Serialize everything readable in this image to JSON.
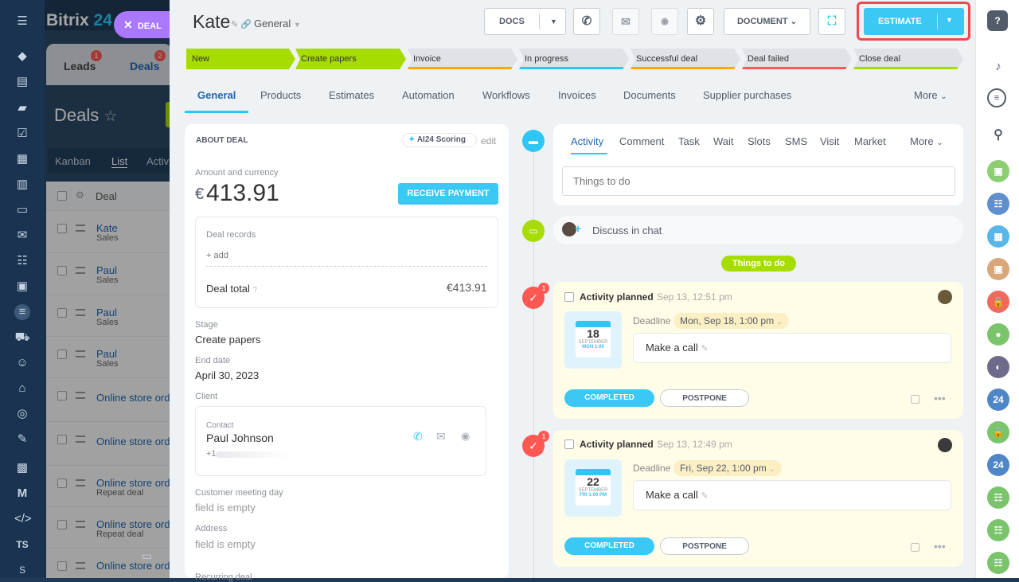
{
  "brand": {
    "name": "Bitrix",
    "num": "24",
    "chip": "DEAL"
  },
  "bg": {
    "tabs": [
      {
        "label": "Leads",
        "badge": "1"
      },
      {
        "label": "Deals",
        "badge": "2"
      }
    ],
    "title": "Deals",
    "view_tabs": [
      "Kanban",
      "List",
      "Activi"
    ],
    "col_deal": "Deal",
    "rows": [
      {
        "name": "Kate",
        "sub": "Sales"
      },
      {
        "name": "Paul",
        "sub": "Sales"
      },
      {
        "name": "Paul",
        "sub": "Sales"
      },
      {
        "name": "Paul",
        "sub": "Sales"
      },
      {
        "name": "Online store ord",
        "sub": ""
      },
      {
        "name": "Online store ord",
        "sub": ""
      },
      {
        "name": "Online store ord",
        "sub": "Repeat deal"
      },
      {
        "name": "Online store ord",
        "sub": "Repeat deal"
      },
      {
        "name": "Online store ord",
        "sub": ""
      }
    ],
    "rail_ts": "TS",
    "rail_s": "S"
  },
  "header": {
    "title": "Kate",
    "category": "General",
    "docs_label": "DOCS",
    "document_label": "DOCUMENT",
    "estimate_label": "ESTIMATE"
  },
  "stages": [
    {
      "label": "New",
      "color": "#a6dc00",
      "done": true
    },
    {
      "label": "Create papers",
      "color": "#a6dc00",
      "done": true
    },
    {
      "label": "Invoice",
      "color": "#ffa900",
      "done": false
    },
    {
      "label": "In progress",
      "color": "#2fc6f6",
      "done": false
    },
    {
      "label": "Successful deal",
      "color": "#ffa900",
      "done": false
    },
    {
      "label": "Deal failed",
      "color": "#ff5752",
      "done": false
    },
    {
      "label": "Close deal",
      "color": "#a6dc00",
      "done": false
    }
  ],
  "tabs": [
    "General",
    "Products",
    "Estimates",
    "Automation",
    "Workflows",
    "Invoices",
    "Documents",
    "Supplier purchases",
    "More"
  ],
  "about": {
    "heading": "ABOUT DEAL",
    "scoring": "AI24 Scoring",
    "edit": "edit",
    "amount_label": "Amount and currency",
    "amount_currency": "€",
    "amount": "413.91",
    "receive_payment": "RECEIVE PAYMENT",
    "records_label": "Deal records",
    "add": "+ add",
    "total_label": "Deal total",
    "total_value": "€413.91",
    "stage_label": "Stage",
    "stage_value": "Create papers",
    "end_label": "End date",
    "end_value": "April 30, 2023",
    "client_label": "Client",
    "contact_label": "Contact",
    "contact_name": "Paul Johnson",
    "contact_phone": "+1",
    "meeting_label": "Customer meeting day",
    "meeting_value": "field is empty",
    "address_label": "Address",
    "address_value": "field is empty",
    "recurring_label": "Recurring deal"
  },
  "activity": {
    "tabs": [
      "Activity",
      "Comment",
      "Task",
      "Wait",
      "Slots",
      "SMS",
      "Visit",
      "Market",
      "More"
    ],
    "placeholder": "Things to do",
    "discuss": "Discuss in chat",
    "things_badge": "Things to do"
  },
  "tasks": [
    {
      "badge": "1",
      "title": "Activity planned",
      "time": "Sep 13, 12:51 pm",
      "deadline_label": "Deadline",
      "deadline": "Mon, Sep 18, 1:00 pm",
      "cal_day": "18",
      "cal_month": "SEPTEMBER",
      "cal_time": "MON 1:00",
      "text": "Make a call",
      "completed": "COMPLETED",
      "postpone": "POSTPONE"
    },
    {
      "badge": "1",
      "title": "Activity planned",
      "time": "Sep 13, 12:49 pm",
      "deadline_label": "Deadline",
      "deadline": "Fri, Sep 22, 1:00 pm",
      "cal_day": "22",
      "cal_month": "SEPTEMBER",
      "cal_time": "FRI 1:00 PM",
      "text": "Make a call",
      "completed": "COMPLETED",
      "postpone": "POSTPONE"
    }
  ],
  "right_panel": {
    "badge_24": "24"
  },
  "colors": {
    "accent": "#2fc6f6",
    "green": "#a6dc00",
    "red": "#ff5752",
    "link": "#2067b0"
  }
}
